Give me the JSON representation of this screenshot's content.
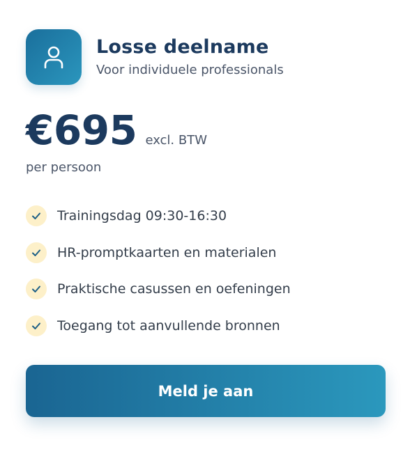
{
  "plan": {
    "title": "Losse deelname",
    "subtitle": "Voor individuele professionals",
    "icon": "user-icon"
  },
  "pricing": {
    "price": "€695",
    "suffix": "excl. BTW",
    "unit": "per persoon"
  },
  "features": [
    "Trainingsdag 09:30-16:30",
    "HR-promptkaarten en materialen",
    "Praktische casussen en oefeningen",
    "Toegang tot aanvullende bronnen"
  ],
  "cta": {
    "label": "Meld je aan"
  },
  "colors": {
    "accent": "#1c6e9b",
    "accent_light": "#2b98bd",
    "heading": "#1c3a5e",
    "check_bg": "#fdf0c9",
    "check_stroke": "#1c5f86"
  }
}
